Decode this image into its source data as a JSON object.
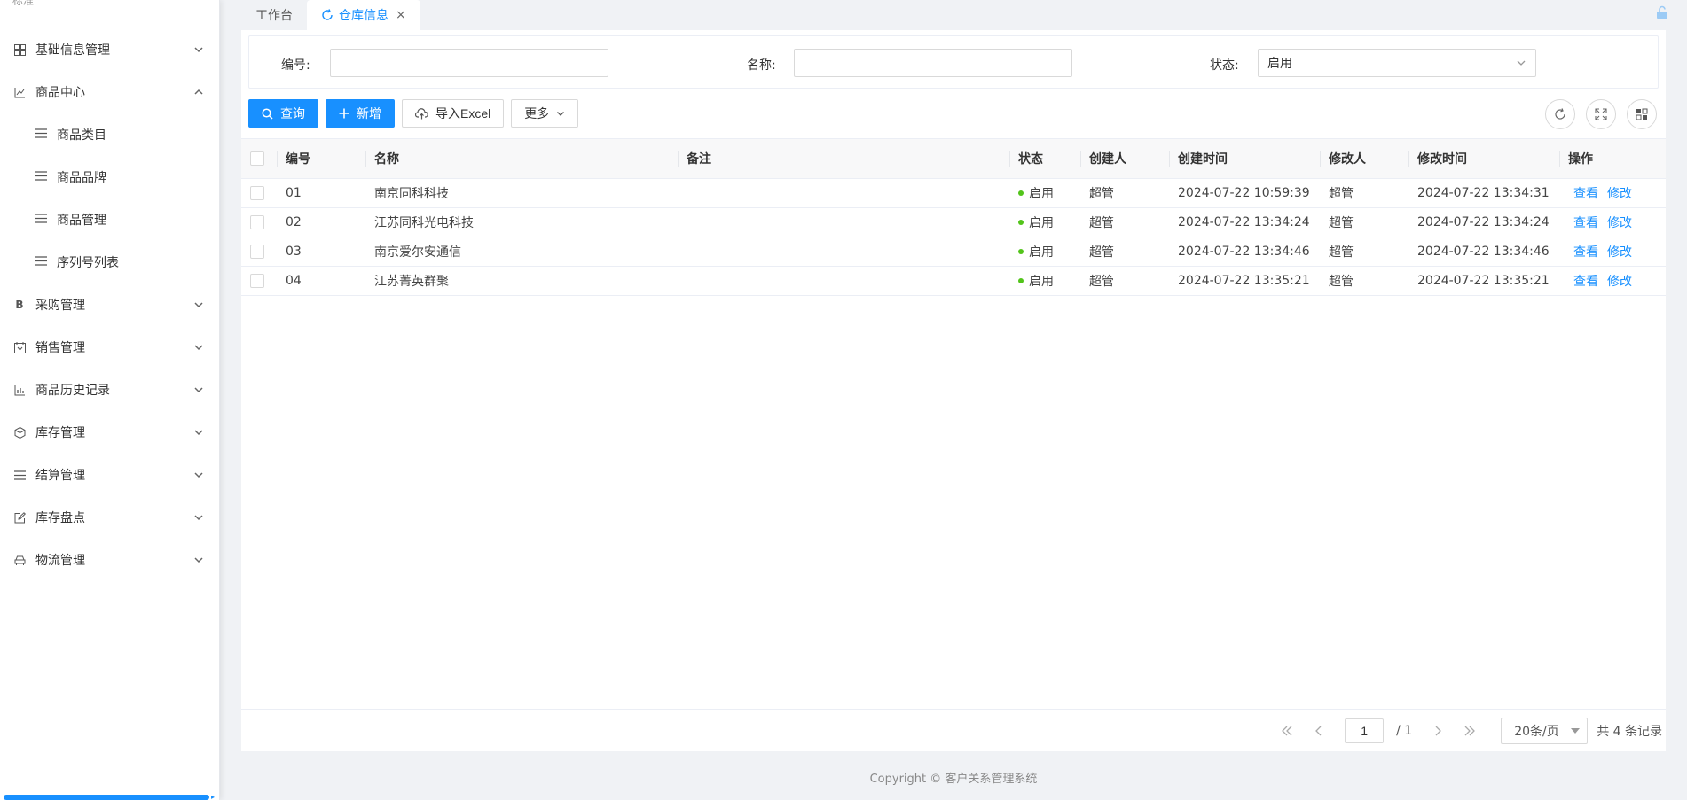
{
  "sidebar": {
    "logo_text": "标准",
    "items": [
      {
        "label": "基础信息管理"
      },
      {
        "label": "商品中心"
      },
      {
        "label": "商品类目"
      },
      {
        "label": "商品品牌"
      },
      {
        "label": "商品管理"
      },
      {
        "label": "序列号列表"
      },
      {
        "label": "采购管理"
      },
      {
        "label": "销售管理"
      },
      {
        "label": "商品历史记录"
      },
      {
        "label": "库存管理"
      },
      {
        "label": "结算管理"
      },
      {
        "label": "库存盘点"
      },
      {
        "label": "物流管理"
      }
    ]
  },
  "tabs": [
    {
      "label": "工作台"
    },
    {
      "label": "仓库信息"
    }
  ],
  "filter": {
    "code_label": "编号:",
    "code_value": "",
    "name_label": "名称:",
    "name_value": "",
    "status_label": "状态:",
    "status_value": "启用"
  },
  "toolbar": {
    "search": "查询",
    "add": "新增",
    "import": "导入Excel",
    "more": "更多"
  },
  "table": {
    "headers": {
      "code": "编号",
      "name": "名称",
      "remark": "备注",
      "status": "状态",
      "creator": "创建人",
      "create_time": "创建时间",
      "modifier": "修改人",
      "modify_time": "修改时间",
      "ops": "操作"
    },
    "rows": [
      {
        "code": "01",
        "name": "南京同科科技",
        "remark": "",
        "status": "启用",
        "creator": "超管",
        "create_time": "2024-07-22 10:59:39",
        "modifier": "超管",
        "modify_time": "2024-07-22 13:34:31",
        "view": "查看",
        "edit": "修改"
      },
      {
        "code": "02",
        "name": "江苏同科光电科技",
        "remark": "",
        "status": "启用",
        "creator": "超管",
        "create_time": "2024-07-22 13:34:24",
        "modifier": "超管",
        "modify_time": "2024-07-22 13:34:24",
        "view": "查看",
        "edit": "修改"
      },
      {
        "code": "03",
        "name": "南京爱尔安通信",
        "remark": "",
        "status": "启用",
        "creator": "超管",
        "create_time": "2024-07-22 13:34:46",
        "modifier": "超管",
        "modify_time": "2024-07-22 13:34:46",
        "view": "查看",
        "edit": "修改"
      },
      {
        "code": "04",
        "name": "江苏菁英群聚",
        "remark": "",
        "status": "启用",
        "creator": "超管",
        "create_time": "2024-07-22 13:35:21",
        "modifier": "超管",
        "modify_time": "2024-07-22 13:35:21",
        "view": "查看",
        "edit": "修改"
      }
    ]
  },
  "pager": {
    "current_page": "1",
    "total_pages": "/ 1",
    "page_size": "20条/页",
    "total": "共 4 条记录"
  },
  "footer": {
    "text": "Copyright © 客户关系管理系统"
  },
  "colors": {
    "primary": "#1890ff",
    "status_ok": "#52c41a"
  }
}
